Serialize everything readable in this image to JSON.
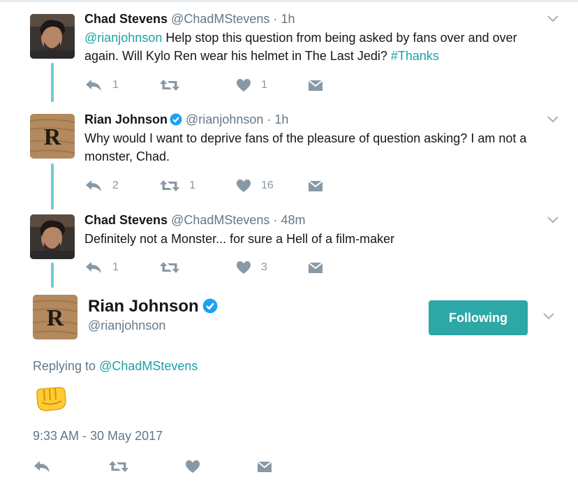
{
  "thread": [
    {
      "name": "Chad Stevens",
      "verified": false,
      "handle": "@ChadMStevens",
      "dot": "·",
      "time": "1h",
      "mention": "@rianjohnson",
      "text": " Help stop this question from being asked by fans over and over again. Will Kylo Ren wear his helmet in The Last Jedi? ",
      "hashtag": "#Thanks",
      "replies": "1",
      "retweets": "",
      "likes": "1"
    },
    {
      "name": "Rian Johnson",
      "verified": true,
      "handle": "@rianjohnson",
      "dot": "·",
      "time": "1h",
      "text": "Why would I want to deprive fans of the pleasure of question asking? I am not a monster, Chad.",
      "replies": "2",
      "retweets": "1",
      "likes": "16"
    },
    {
      "name": "Chad Stevens",
      "verified": false,
      "handle": "@ChadMStevens",
      "dot": "·",
      "time": "48m",
      "text": "Definitely not a Monster... for sure a Hell of a film-maker",
      "replies": "1",
      "retweets": "",
      "likes": "3"
    }
  ],
  "main": {
    "name": "Rian Johnson",
    "handle": "@rianjohnson",
    "follow_label": "Following",
    "replying_prefix": "Replying to ",
    "replying_handle": "@ChadMStevens",
    "emoji": "fist-bump-emoji",
    "timestamp": "9:33 AM - 30 May 2017"
  },
  "colors": {
    "accent": "#2ea7a7",
    "link": "#1da1a5",
    "thread_line": "#71c9d0",
    "verified": "#1da1f2",
    "icon": "#8899a6"
  },
  "icons": [
    "reply-icon",
    "retweet-icon",
    "heart-icon",
    "direct-message-icon",
    "chevron-down-icon",
    "verified-badge-icon"
  ]
}
